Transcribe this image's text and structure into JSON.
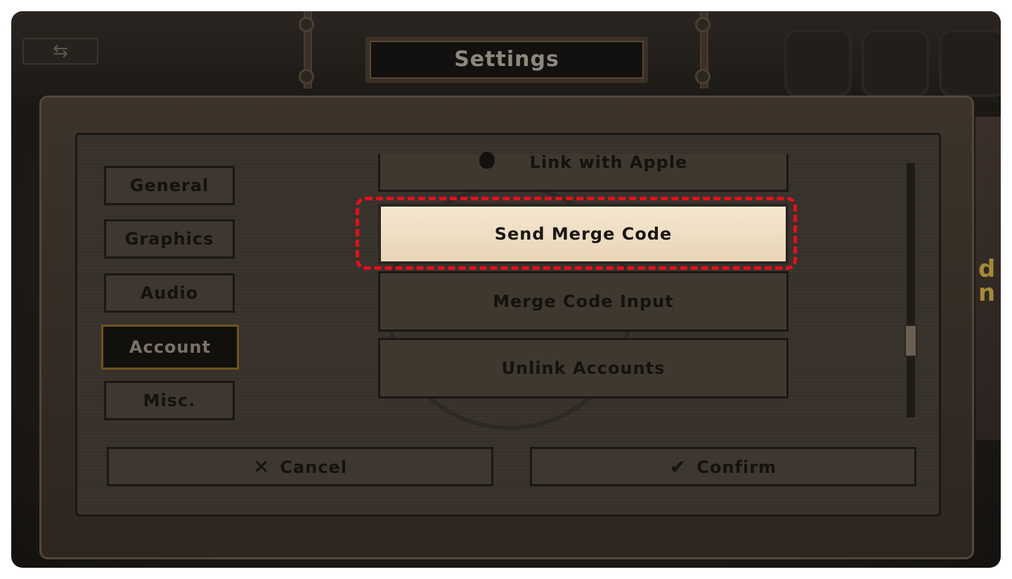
{
  "header": {
    "title": "Settings",
    "back_icon": "back-arrows-icon"
  },
  "tabs": [
    {
      "label": "General",
      "active": false
    },
    {
      "label": "Graphics",
      "active": false
    },
    {
      "label": "Audio",
      "active": false
    },
    {
      "label": "Account",
      "active": true
    },
    {
      "label": "Misc.",
      "active": false
    }
  ],
  "account_options": [
    {
      "label": "Link with Apple",
      "icon": "apple-icon"
    },
    {
      "label": "Send Merge Code",
      "highlighted": true
    },
    {
      "label": "Merge Code Input"
    },
    {
      "label": "Unlink Accounts"
    }
  ],
  "footer": {
    "cancel_label": "Cancel",
    "cancel_icon": "x-icon",
    "confirm_label": "Confirm",
    "confirm_icon": "checkmark-icon"
  },
  "colors": {
    "highlight_outline": "#e3101d",
    "active_tab_border": "#6e521e",
    "highlight_button": "#f5e7d0"
  },
  "background_text": "d n"
}
